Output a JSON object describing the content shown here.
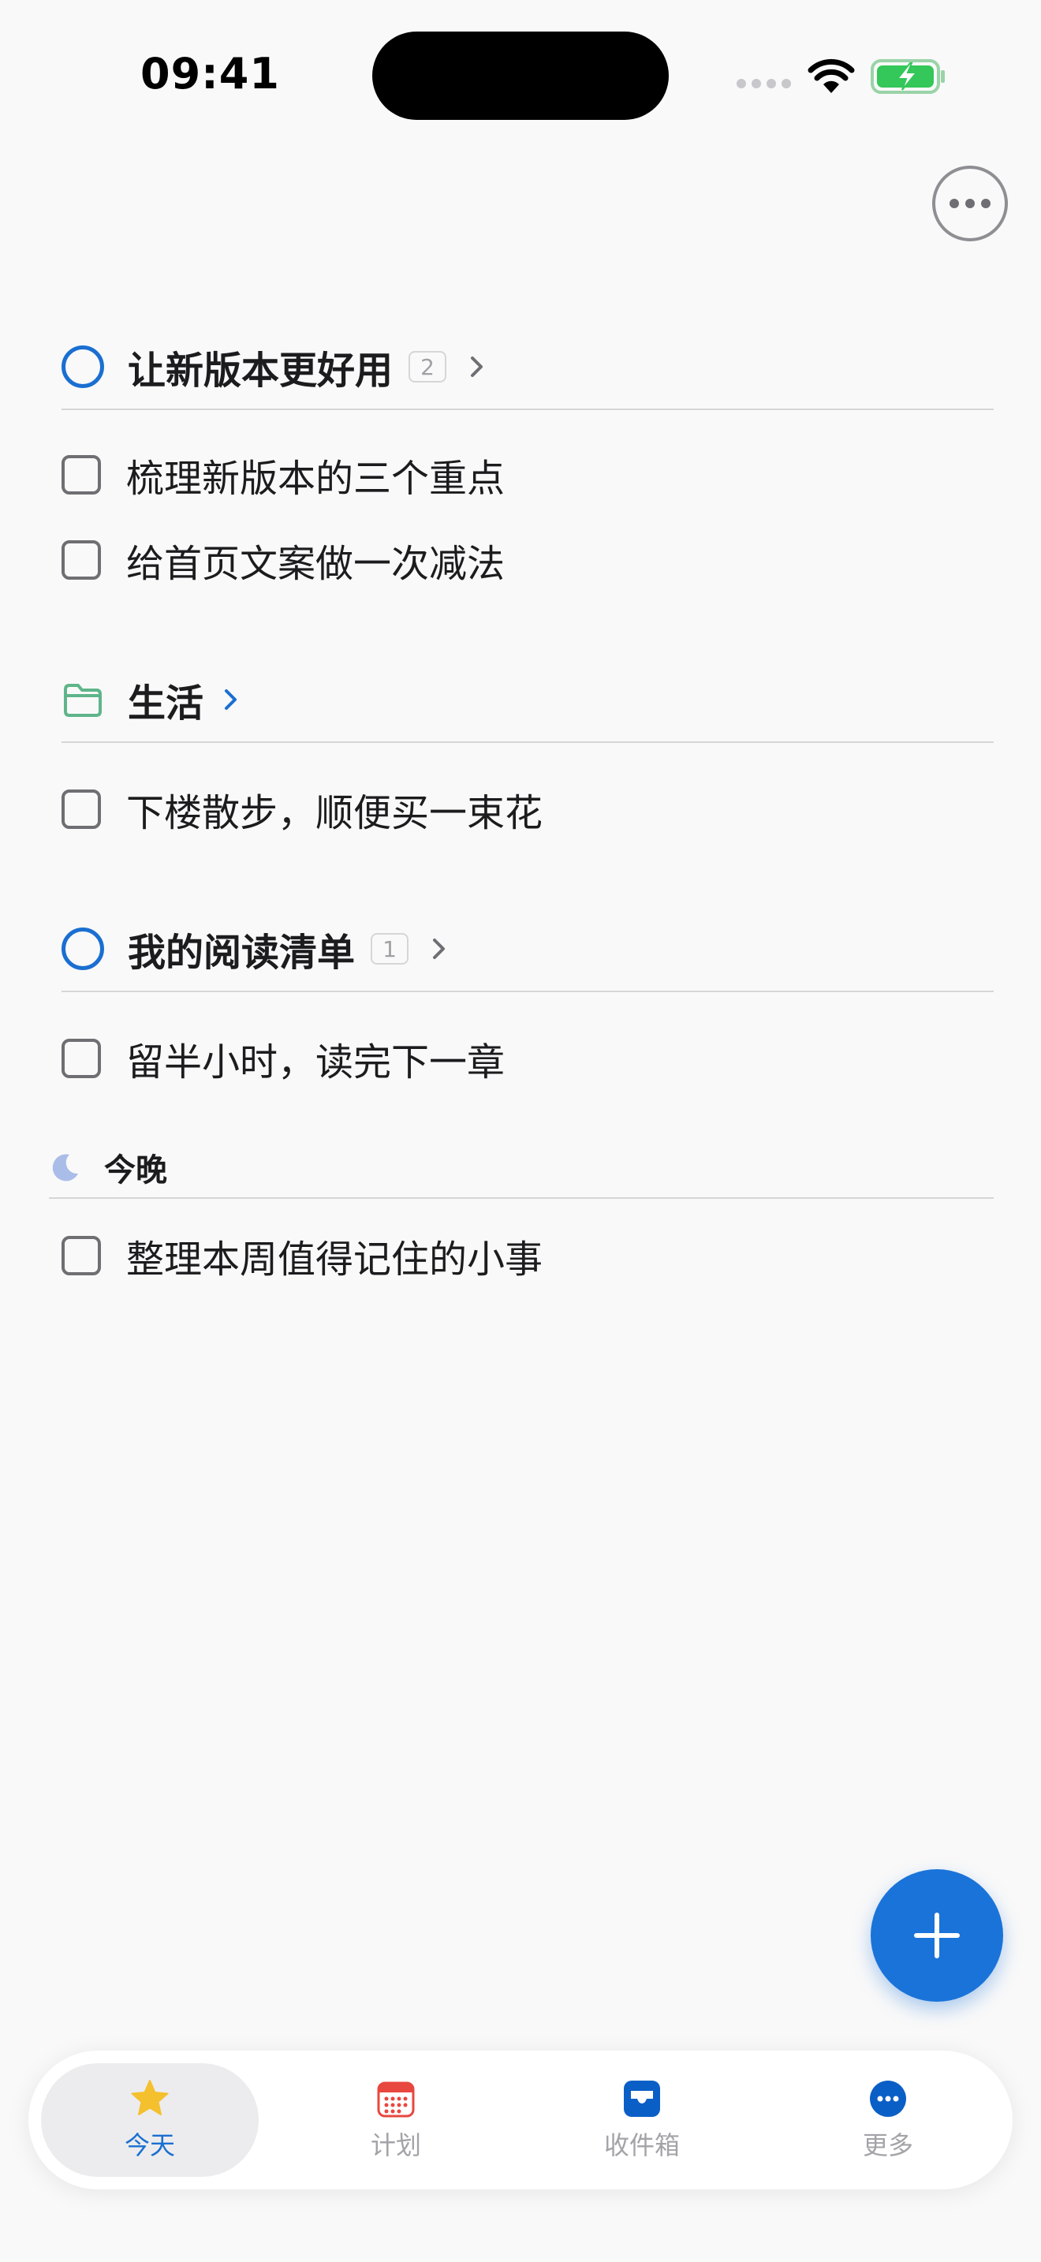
{
  "status_bar": {
    "time": "09:41"
  },
  "sections": [
    {
      "title": "让新版本更好用",
      "count": "2",
      "tasks": [
        "梳理新版本的三个重点",
        "给首页文案做一次减法"
      ]
    },
    {
      "title": "生活",
      "tasks": [
        "下楼散步，顺便买一束花"
      ]
    },
    {
      "title": "我的阅读清单",
      "count": "1",
      "tasks": [
        "留半小时，读完下一章"
      ]
    }
  ],
  "evening": {
    "title": "今晚",
    "tasks": [
      "整理本周值得记住的小事"
    ]
  },
  "tabbar": {
    "items": [
      {
        "label": "今天",
        "icon": "star-icon"
      },
      {
        "label": "计划",
        "icon": "calendar-icon"
      },
      {
        "label": "收件箱",
        "icon": "inbox-icon"
      },
      {
        "label": "更多",
        "icon": "more-circle-icon"
      }
    ]
  },
  "colors": {
    "accent": "#1a6fd1",
    "fab": "#1a73d9",
    "folder_green": "#5fb58a",
    "calendar_red": "#e8473f",
    "star_yellow": "#f5c02e",
    "moon_blue": "#a9bde8"
  }
}
